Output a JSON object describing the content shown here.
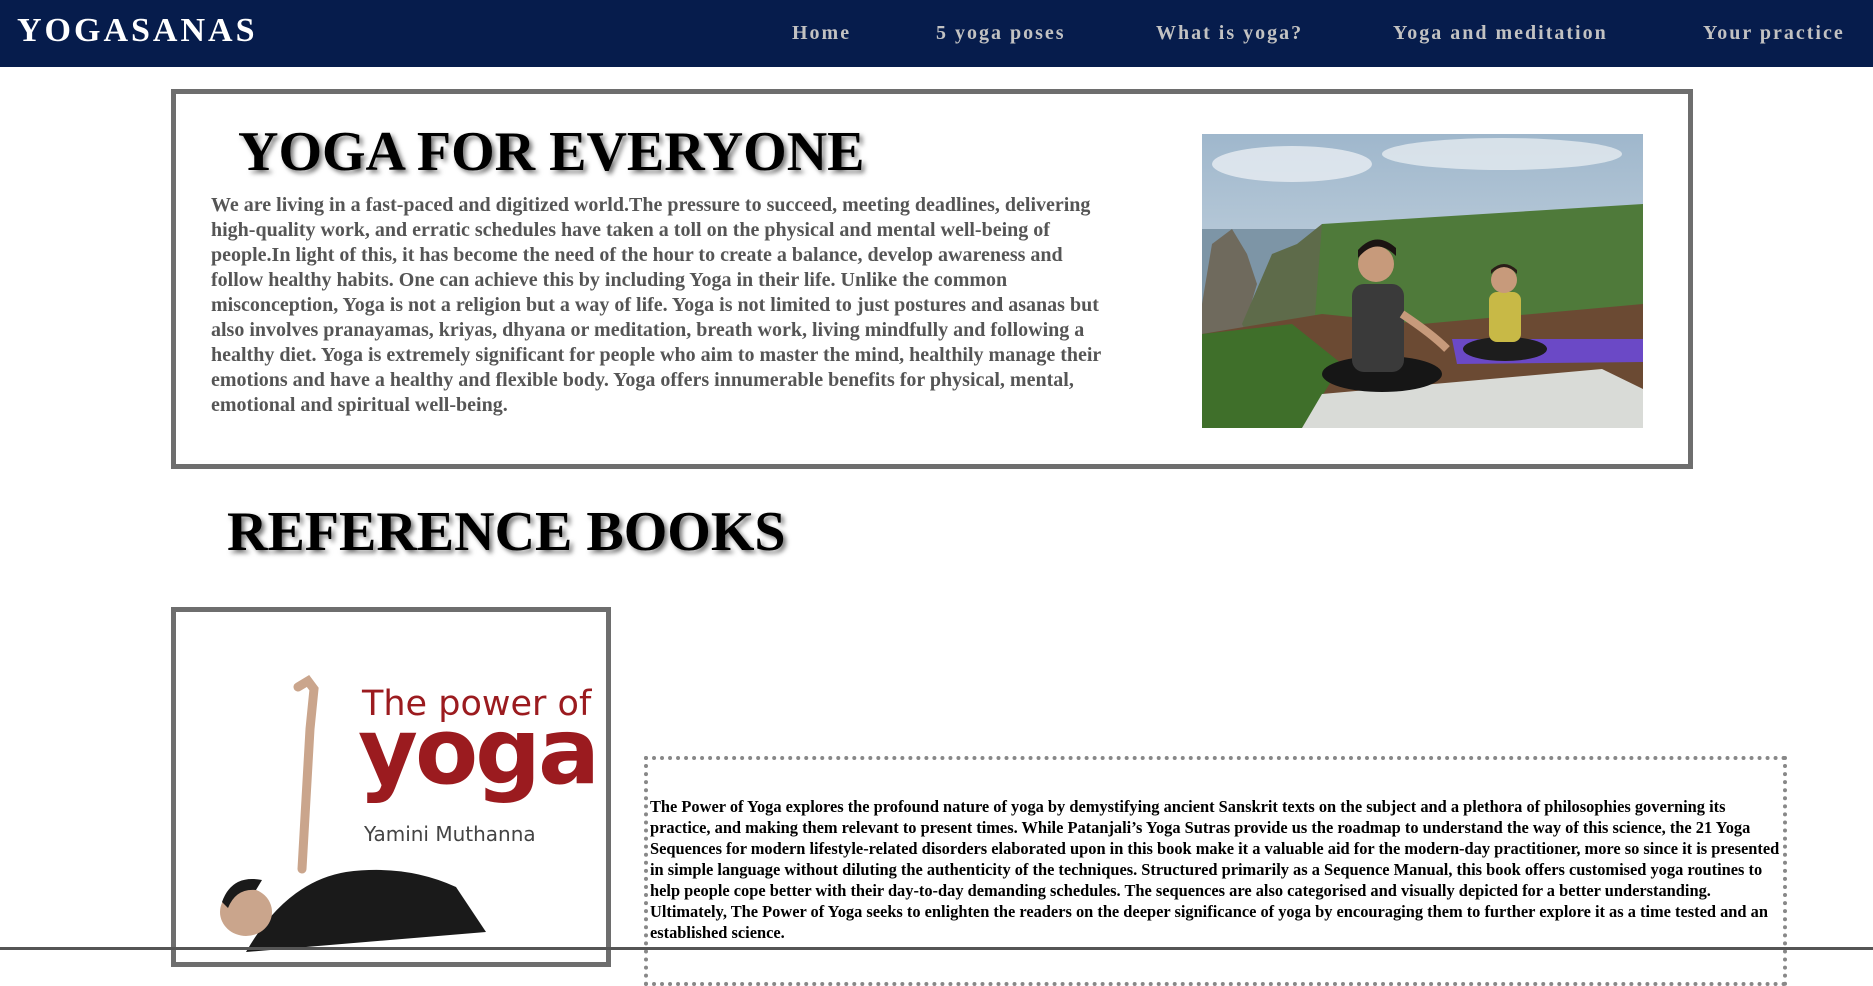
{
  "brand": "YOGASANAS",
  "nav": {
    "items": [
      "Home",
      "5 yoga poses",
      "What is yoga?",
      "Yoga and meditation",
      "Your practice"
    ]
  },
  "hero": {
    "title": "YOGA FOR EVERYONE",
    "text": "We are living in a fast-paced and digitized world.The pressure to succeed, meeting deadlines, delivering high-quality work, and erratic schedules have taken a toll on the physical and mental well-being of people.In light of this, it has become the need of the hour to create a balance, develop awareness and follow healthy habits. One can achieve this by including Yoga in their life. Unlike the common misconception, Yoga is not a religion but a way of life. Yoga is not limited to just postures and asanas but also involves pranayamas, kriyas, dhyana or meditation, breath work, living mindfully and following a healthy diet. Yoga is extremely significant for people who aim to master the mind, healthily manage their emotions and have a healthy and flexible body. Yoga offers innumerable benefits for physical, mental, emotional and spiritual well-being."
  },
  "references": {
    "title": "REFERENCE BOOKS",
    "book": {
      "cover_title_line1": "The power of",
      "cover_title_line2": "yoga",
      "cover_author": "Yamini Muthanna",
      "description": "The Power of Yoga explores the profound nature of yoga by demystifying ancient Sanskrit texts on the subject and a plethora of philosophies governing its practice, and making them relevant to present times. While Patanjali’s Yoga Sutras provide us the roadmap to understand the way of this science, the 21 Yoga Sequences for modern lifestyle-related disorders elaborated upon in this book make it a valuable aid for the modern-day practitioner, more so since it is presented in simple language without diluting the authenticity of the techniques. Structured primarily as a Sequence Manual, this book offers customised yoga routines to help people cope better with their day-to-day demanding schedules. The sequences are also categorised and visually depicted for a better understanding. Ultimately, The Power of Yoga seeks to enlighten the readers on the deeper significance of yoga by encouraging them to further explore it as a time tested and an established science."
    }
  },
  "colors": {
    "nav_bg": "#061c4c",
    "nav_text": "#c2c2c2",
    "brand_text": "#ffffff",
    "cover_red": "#9b1b1f"
  }
}
